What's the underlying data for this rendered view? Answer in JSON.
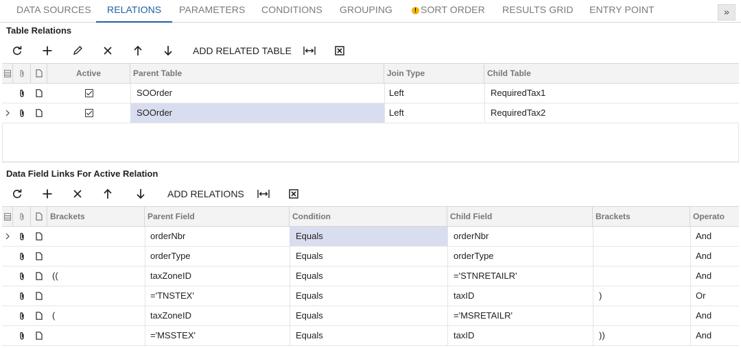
{
  "tabs": [
    {
      "label": "DATA SOURCES",
      "active": false
    },
    {
      "label": "RELATIONS",
      "active": true
    },
    {
      "label": "PARAMETERS",
      "active": false
    },
    {
      "label": "CONDITIONS",
      "active": false
    },
    {
      "label": "GROUPING",
      "active": false
    },
    {
      "label": "SORT ORDER",
      "active": false,
      "warning": true
    },
    {
      "label": "RESULTS GRID",
      "active": false
    },
    {
      "label": "ENTRY POINT",
      "active": false
    }
  ],
  "more_tabs_icon": "chevron-double-right-icon",
  "table_relations": {
    "title": "Table Relations",
    "toolbar": {
      "refresh_icon": "refresh-icon",
      "add_icon": "plus-icon",
      "edit_icon": "pencil-icon",
      "delete_icon": "x-icon",
      "up_icon": "arrow-up-icon",
      "down_icon": "arrow-down-icon",
      "add_related_label": "ADD RELATED TABLE",
      "fit_icon": "fit-width-icon",
      "excel_icon": "export-excel-icon"
    },
    "columns": {
      "active": "Active",
      "parent_table": "Parent Table",
      "join_type": "Join Type",
      "child_table": "Child Table"
    },
    "rows": [
      {
        "active": true,
        "parent_table": "SOOrder",
        "join_type": "Left",
        "child_table": "RequiredTax1",
        "selected": false
      },
      {
        "active": true,
        "parent_table": "SOOrder",
        "join_type": "Left",
        "child_table": "RequiredTax2",
        "selected": true
      }
    ]
  },
  "field_links": {
    "title": "Data Field Links For Active Relation",
    "toolbar": {
      "refresh_icon": "refresh-icon",
      "add_icon": "plus-icon",
      "delete_icon": "x-icon",
      "up_icon": "arrow-up-icon",
      "down_icon": "arrow-down-icon",
      "add_relations_label": "ADD RELATIONS",
      "fit_icon": "fit-width-icon",
      "excel_icon": "export-excel-icon"
    },
    "columns": {
      "brackets_open": "Brackets",
      "parent_field": "Parent Field",
      "condition": "Condition",
      "child_field": "Child Field",
      "brackets_close": "Brackets",
      "operator": "Operato"
    },
    "rows": [
      {
        "brackets_open": "",
        "parent_field": "orderNbr",
        "condition": "Equals",
        "child_field": "orderNbr",
        "brackets_close": "",
        "operator": "And",
        "selected": true
      },
      {
        "brackets_open": "",
        "parent_field": "orderType",
        "condition": "Equals",
        "child_field": "orderType",
        "brackets_close": "",
        "operator": "And",
        "selected": false
      },
      {
        "brackets_open": "((",
        "parent_field": "taxZoneID",
        "condition": "Equals",
        "child_field": "='STNRETAILR'",
        "brackets_close": "",
        "operator": "And",
        "selected": false
      },
      {
        "brackets_open": "",
        "parent_field": "='TNSTEX'",
        "condition": "Equals",
        "child_field": "taxID",
        "brackets_close": ")",
        "operator": "Or",
        "selected": false
      },
      {
        "brackets_open": "(",
        "parent_field": "taxZoneID",
        "condition": "Equals",
        "child_field": "='MSRETAILR'",
        "brackets_close": "",
        "operator": "And",
        "selected": false
      },
      {
        "brackets_open": "",
        "parent_field": "='MSSTEX'",
        "condition": "Equals",
        "child_field": "taxID",
        "brackets_close": "))",
        "operator": "And",
        "selected": false
      }
    ]
  }
}
